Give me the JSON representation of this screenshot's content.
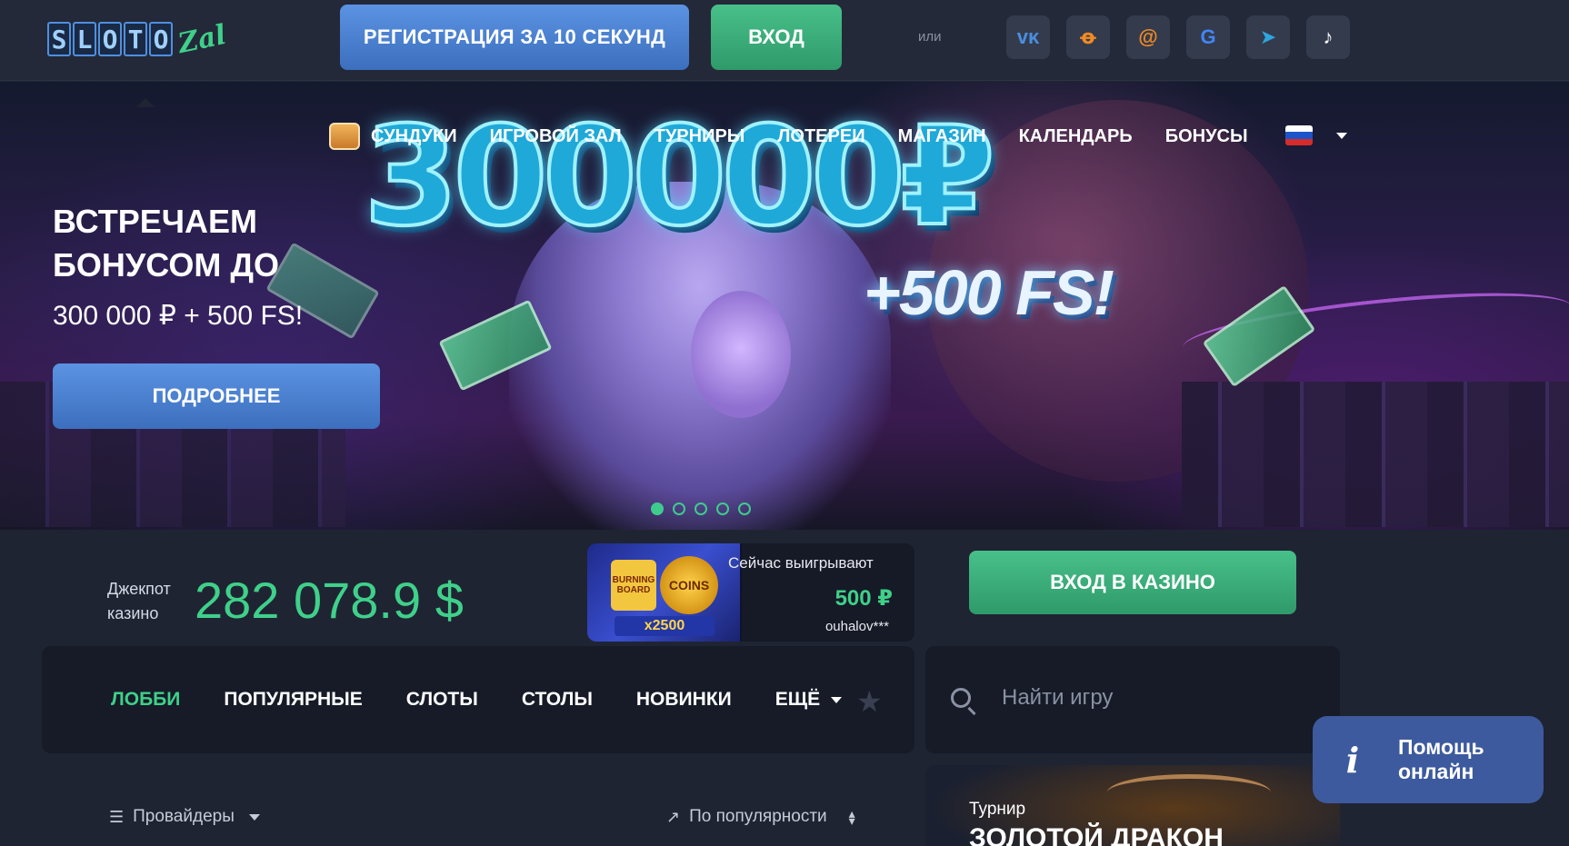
{
  "header": {
    "logo_tiles": [
      "S",
      "L",
      "O",
      "T",
      "O"
    ],
    "logo_script": "Zal",
    "register_label": "РЕГИСТРАЦИЯ ЗА 10 СЕКУНД",
    "login_label": "ВХОД",
    "or_label": "или",
    "socials": [
      {
        "icon": "vk-icon",
        "glyph": "ᴠᴋ",
        "color": "#4a8fe0"
      },
      {
        "icon": "odnoklassniki-icon",
        "glyph": "ꝋ",
        "color": "#f08a24"
      },
      {
        "icon": "mail-icon",
        "glyph": "@",
        "color": "#f08a24"
      },
      {
        "icon": "google-icon",
        "glyph": "G",
        "color": "#4285f4"
      },
      {
        "icon": "telegram-icon",
        "glyph": "➤",
        "color": "#2ea5e0"
      },
      {
        "icon": "tiktok-icon",
        "glyph": "♪",
        "color": "#ffffff"
      }
    ]
  },
  "nav": {
    "items": [
      {
        "label": "СУНДУКИ",
        "name": "nav-chests"
      },
      {
        "label": "ИГРОВОЙ ЗАЛ",
        "name": "nav-game-hall"
      },
      {
        "label": "ТУРНИРЫ",
        "name": "nav-tournaments"
      },
      {
        "label": "ЛОТЕРЕИ",
        "name": "nav-lotteries"
      },
      {
        "label": "МАГАЗИН",
        "name": "nav-shop"
      },
      {
        "label": "КАЛЕНДАРЬ",
        "name": "nav-calendar"
      },
      {
        "label": "БОНУСЫ",
        "name": "nav-bonuses"
      }
    ],
    "language": "ru"
  },
  "hero": {
    "title": "ВСТРЕЧАЕМ БОНУСОМ ДО",
    "subtitle": "300 000 ₽ + 500 FS!",
    "button_label": "ПОДРОБНЕЕ",
    "banner_amount": "300000₽",
    "banner_fs": "+500 FS!",
    "slides_total": 5,
    "active_slide": 1
  },
  "jackpot": {
    "label": "Джекпот казино",
    "value": "282 078.9 $"
  },
  "winners": {
    "label": "Сейчас выигрывают",
    "game_tile_1": "BURNING BOARD",
    "game_tile_2": "COINS",
    "multiplier": "x2500",
    "amount": "500 ₽",
    "user": "ouhalov***"
  },
  "casino_button": "ВХОД В КАЗИНО",
  "tabs": [
    {
      "label": "ЛОББИ",
      "active": true
    },
    {
      "label": "ПОПУЛЯРНЫЕ",
      "active": false
    },
    {
      "label": "СЛОТЫ",
      "active": false
    },
    {
      "label": "СТОЛЫ",
      "active": false
    },
    {
      "label": "НОВИНКИ",
      "active": false
    },
    {
      "label": "ЕЩЁ",
      "active": false,
      "dropdown": true
    }
  ],
  "search": {
    "placeholder": "Найти игру"
  },
  "filters": {
    "providers_label": "Провайдеры",
    "sort_label": "По популярности"
  },
  "tournament": {
    "label": "Турнир",
    "name": "ЗОЛОТОЙ ДРАКОН"
  },
  "help": {
    "label_line1": "Помощь",
    "label_line2": "онлайн"
  },
  "colors": {
    "accent_green": "#3fd08a",
    "accent_blue": "#4f84d6",
    "background": "#1f2433"
  }
}
